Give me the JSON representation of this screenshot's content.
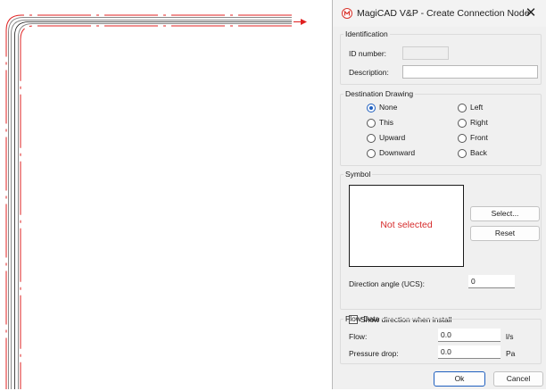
{
  "window": {
    "title": "MagiCAD V&P - Create Connection Node",
    "close_glyph": "✕"
  },
  "identification": {
    "legend": "Identification",
    "id_label": "ID number:",
    "id_value": "",
    "description_label": "Description:",
    "description_value": ""
  },
  "destination": {
    "legend": "Destination Drawing",
    "options": [
      {
        "label": "None",
        "checked": true
      },
      {
        "label": "This",
        "checked": false
      },
      {
        "label": "Upward",
        "checked": false
      },
      {
        "label": "Downward",
        "checked": false
      },
      {
        "label": "Left",
        "checked": false
      },
      {
        "label": "Right",
        "checked": false
      },
      {
        "label": "Front",
        "checked": false
      },
      {
        "label": "Back",
        "checked": false
      }
    ]
  },
  "symbol": {
    "legend": "Symbol",
    "preview_text": "Not selected",
    "select_label": "Select...",
    "reset_label": "Reset",
    "direction_label": "Direction angle (UCS):",
    "direction_value": "0",
    "show_direction_label": "Show direction when install",
    "show_direction_checked": false
  },
  "flow": {
    "legend": "Flow Data",
    "flow_label": "Flow:",
    "flow_value": "0.0",
    "flow_unit": "l/s",
    "pressure_label": "Pressure drop:",
    "pressure_value": "0.0",
    "pressure_unit": "Pa"
  },
  "buttons": {
    "ok_label": "Ok",
    "cancel_label": "Cancel"
  },
  "colors": {
    "duct_red": "#e02020",
    "duct_gray": "#8a8a8a",
    "accent": "#1f5fbf",
    "not_selected": "#d62b2b"
  },
  "icons": {
    "app": "magicad-logo-icon",
    "arrow": "arrow-right-icon"
  }
}
